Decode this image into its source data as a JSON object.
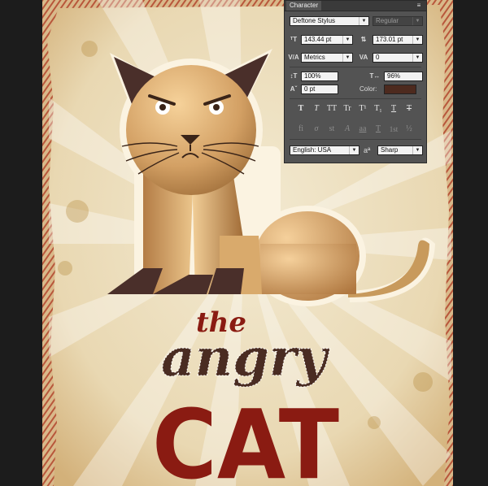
{
  "poster": {
    "line1": "the",
    "line2": "angry",
    "line3": "CAT",
    "colors": {
      "title_red": "#8a1b12",
      "angry_brown": "#4a2c22",
      "paper": "#efe2c2",
      "cat_fur": "#c89a5c"
    }
  },
  "panel": {
    "tab_label": "Character",
    "menu_icon": "panel-menu-icon",
    "font_family": "Deftone Stylus",
    "font_style": "Regular",
    "font_size": "143.44 pt",
    "leading": "173.01 pt",
    "kerning": "Metrics",
    "tracking": "0",
    "vertical_scale": "100%",
    "horizontal_scale": "96%",
    "baseline_shift": "0 pt",
    "color_label": "Color:",
    "color_value": "#4d2a1e",
    "language": "English: USA",
    "aa_icon_label": "aª",
    "antialias": "Sharp",
    "style_buttons": [
      "T",
      "T",
      "TT",
      "Tr",
      "T¹",
      "T₁",
      "T",
      "T"
    ],
    "opentype_buttons": [
      "fi",
      "σ",
      "st",
      "A",
      "aa",
      "T",
      "1st",
      "½"
    ]
  }
}
